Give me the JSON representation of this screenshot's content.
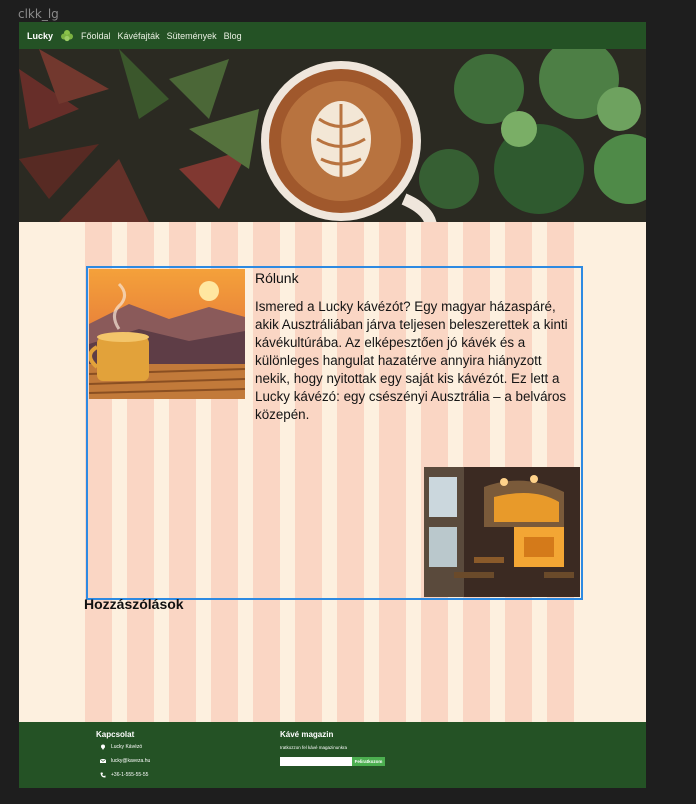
{
  "frame_label": "clkk_lg",
  "nav": {
    "brand": "Lucky",
    "links": [
      "Főoldal",
      "Kávéfajták",
      "Sütemények",
      "Blog"
    ]
  },
  "about": {
    "title": "Rólunk",
    "text": "Ismered a Lucky kávézót? Egy magyar házaspáré, akik Ausztráliában járva teljesen beleszerettek a kinti kávékultúrába. Az elképesztően jó kávék és a különleges hangulat hazatérve annyira hiányzott nekik, hogy nyitottak egy saját kis kávézót. Ez lett a Lucky kávézó: egy csészényi Ausztrália – a belváros közepén."
  },
  "comments_title": "Hozzászólások",
  "footer": {
    "contact": {
      "title": "Kapcsolat",
      "items": [
        {
          "icon": "pin-icon",
          "text": "Lucky Kávézó"
        },
        {
          "icon": "mail-icon",
          "text": "lucky@kaveza.hu"
        },
        {
          "icon": "phone-icon",
          "text": "+36-1-555-55-55"
        }
      ]
    },
    "newsletter": {
      "title": "Kávé magazin",
      "subtitle": "Iratkozzon fel kávé magazinunkra",
      "input_placeholder": "",
      "button_label": "Feliratkozom"
    }
  },
  "colors": {
    "nav_bg": "#245225",
    "page_bg": "#fdf0df",
    "grid_overlay": "#f5a08c",
    "selection": "#2d8ae2",
    "button": "#4caf50"
  }
}
